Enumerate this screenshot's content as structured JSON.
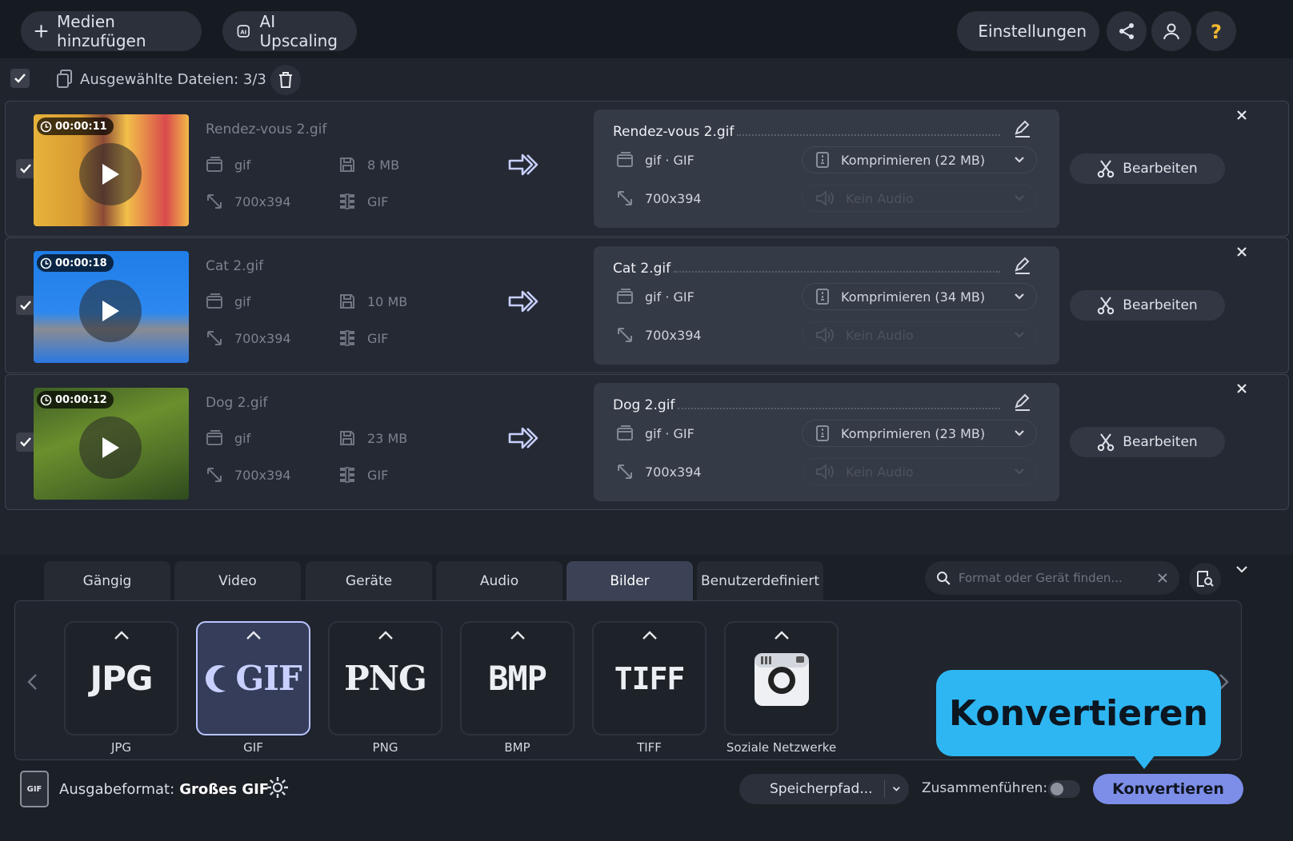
{
  "toolbar": {
    "add_media_label": "Medien hinzufügen",
    "ai_upscaling_label": "AI Upscaling",
    "settings_label": "Einstellungen"
  },
  "selection": {
    "label": "Ausgewählte Dateien: 3/3"
  },
  "files": [
    {
      "duration": "00:00:11",
      "source_name": "Rendez-vous 2.gif",
      "source_ext": "gif",
      "source_size": "8 MB",
      "source_resolution": "700x394",
      "source_codec": "GIF",
      "target_name": "Rendez-vous 2.gif",
      "target_format": "gif · GIF",
      "target_resolution": "700x394",
      "compress_label": "Komprimieren (22 MB)",
      "audio_label": "Kein Audio",
      "edit_label": "Bearbeiten"
    },
    {
      "duration": "00:00:18",
      "source_name": "Cat 2.gif",
      "source_ext": "gif",
      "source_size": "10 MB",
      "source_resolution": "700x394",
      "source_codec": "GIF",
      "target_name": "Cat 2.gif",
      "target_format": "gif · GIF",
      "target_resolution": "700x394",
      "compress_label": "Komprimieren (34 MB)",
      "audio_label": "Kein Audio",
      "edit_label": "Bearbeiten"
    },
    {
      "duration": "00:00:12",
      "source_name": "Dog 2.gif",
      "source_ext": "gif",
      "source_size": "23 MB",
      "source_resolution": "700x394",
      "source_codec": "GIF",
      "target_name": "Dog 2.gif",
      "target_format": "gif · GIF",
      "target_resolution": "700x394",
      "compress_label": "Komprimieren (23 MB)",
      "audio_label": "Kein Audio",
      "edit_label": "Bearbeiten"
    }
  ],
  "tabs": [
    {
      "label": "Gängig"
    },
    {
      "label": "Video"
    },
    {
      "label": "Geräte"
    },
    {
      "label": "Audio"
    },
    {
      "label": "Bilder",
      "active": true
    },
    {
      "label": "Benutzerdefiniert"
    }
  ],
  "search": {
    "placeholder": "Format oder Gerät finden..."
  },
  "formats": [
    {
      "label": "JPG",
      "logo": "JPG"
    },
    {
      "label": "GIF",
      "logo": "GIF",
      "active": true
    },
    {
      "label": "PNG",
      "logo": "PNG"
    },
    {
      "label": "BMP",
      "logo": "BMP"
    },
    {
      "label": "TIFF",
      "logo": "TIFF"
    },
    {
      "label": "Soziale Netzwerke",
      "logo": "camera-icon"
    }
  ],
  "callout": {
    "text": "Konvertieren"
  },
  "footer": {
    "output_format_label": "Ausgabeformat:",
    "output_format_value": "Großes GIF",
    "output_icon_text": "GIF",
    "save_path_label": "Speicherpfad...",
    "merge_label": "Zusammenführen:",
    "convert_label": "Konvertieren"
  },
  "colors": {
    "accent": "#7c8ee8",
    "callout": "#2eb6f2",
    "background": "#20242d",
    "active_format_border": "#b8c4ff"
  }
}
